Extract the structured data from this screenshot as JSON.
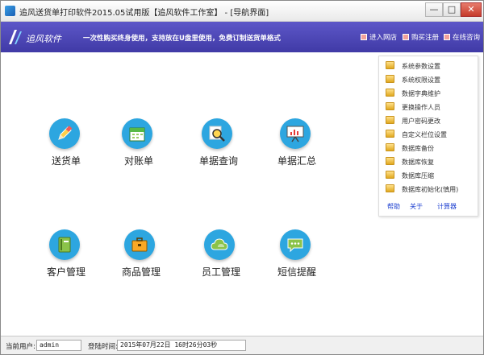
{
  "window": {
    "title": "追风送货单打印软件2015.05试用版【追风软件工作室】 - [导航界面]",
    "minimize": "—",
    "maximize": "□",
    "close": "✕"
  },
  "banner": {
    "logo_text": "追风软件",
    "slogan": "一次性购买终身使用，支持放在U盘里使用，免费订制送货单格式",
    "links": [
      {
        "label": "进入网店",
        "icon": "store-icon"
      },
      {
        "label": "购买注册",
        "icon": "register-icon"
      },
      {
        "label": "在线咨询",
        "icon": "chat-icon"
      }
    ]
  },
  "tiles": [
    {
      "label": "送货单",
      "icon": "pencil-icon"
    },
    {
      "label": "对账单",
      "icon": "calendar-icon"
    },
    {
      "label": "单据查询",
      "icon": "magnifier-icon"
    },
    {
      "label": "单据汇总",
      "icon": "presentation-icon"
    },
    {
      "label": "客户管理",
      "icon": "address-book-icon"
    },
    {
      "label": "商品管理",
      "icon": "briefcase-icon"
    },
    {
      "label": "员工管理",
      "icon": "cloud-icon"
    },
    {
      "label": "短信提醒",
      "icon": "speech-bubble-icon"
    }
  ],
  "menu": {
    "items": [
      "系统参数设置",
      "系统权限设置",
      "数据字典维护",
      "更换操作人员",
      "用户密码更改",
      "自定义栏位设置",
      "数据库备份",
      "数据库恢复",
      "数据库压缩",
      "数据库初始化(慎用)"
    ],
    "footer_links": [
      "帮助",
      "关于",
      "计算器"
    ]
  },
  "status": {
    "user_label": "当前用户:",
    "user_value": "admin",
    "login_label": "登陆时间:",
    "login_value": "2015年07月22日 16时26分03秒"
  }
}
